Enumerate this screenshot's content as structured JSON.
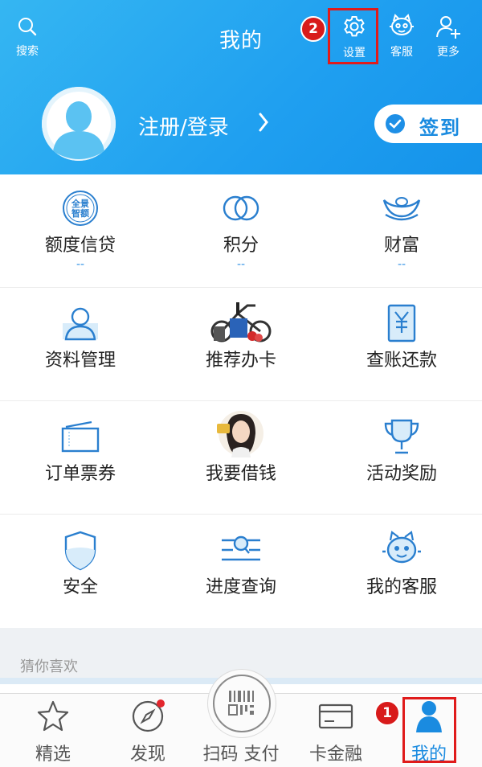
{
  "header": {
    "title": "我的",
    "search_label": "搜索",
    "settings_label": "设置",
    "service_label": "客服",
    "more_label": "更多",
    "login_text": "注册/登录",
    "sign_in_label": "签到",
    "badge_settings": "2"
  },
  "grid": {
    "r1": [
      {
        "name": "额度信贷",
        "sub": "--",
        "icon": "quota-credit-icon",
        "icon_text": "全景智额"
      },
      {
        "name": "积分",
        "sub": "--",
        "icon": "points-icon"
      },
      {
        "name": "财富",
        "sub": "--",
        "icon": "wealth-icon"
      }
    ],
    "r2": [
      {
        "name": "资料管理",
        "icon": "profile-icon"
      },
      {
        "name": "推荐办卡",
        "icon": "recommend-card-image"
      },
      {
        "name": "查账还款",
        "icon": "bill-icon"
      }
    ],
    "r3": [
      {
        "name": "订单票券",
        "icon": "ticket-icon"
      },
      {
        "name": "我要借钱",
        "icon": "borrow-image"
      },
      {
        "name": "活动奖励",
        "icon": "trophy-icon"
      }
    ],
    "r4": [
      {
        "name": "安全",
        "icon": "shield-icon"
      },
      {
        "name": "进度查询",
        "icon": "progress-search-icon"
      },
      {
        "name": "我的客服",
        "icon": "customer-service-icon"
      }
    ]
  },
  "guess_title": "猜你喜欢",
  "tabbar": {
    "featured": "精选",
    "discover": "发现",
    "scan_pay": "扫码 支付",
    "card_finance": "卡金融",
    "mine": "我的",
    "badge_mine": "1"
  },
  "colors": {
    "header_blue": "#1f9ff0",
    "accent_blue": "#1a8be0",
    "highlight_red": "#e01b1b"
  }
}
